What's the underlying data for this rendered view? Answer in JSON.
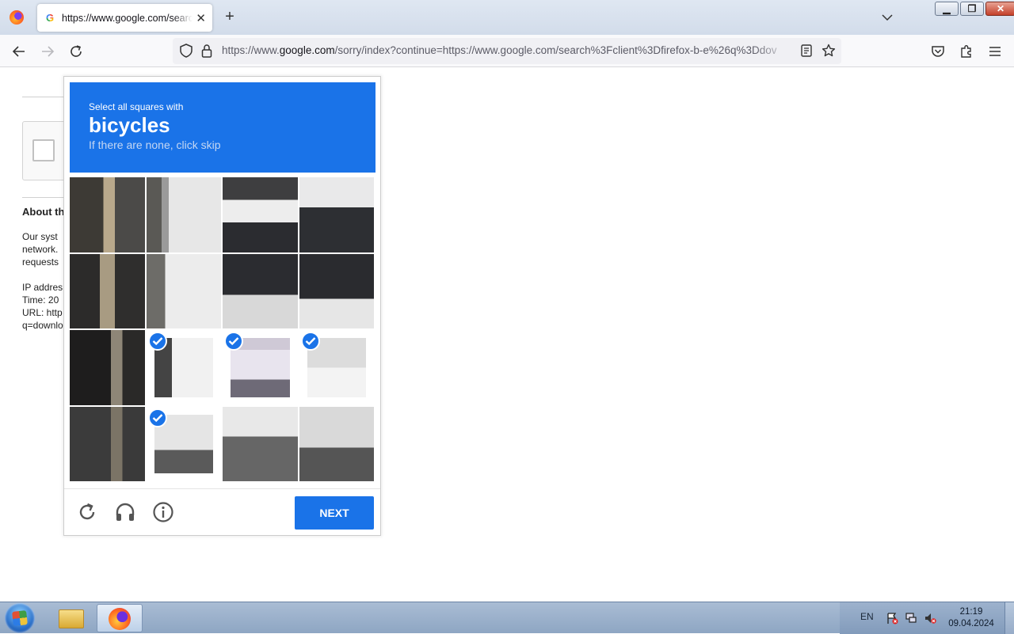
{
  "browser": {
    "tab_title": "https://www.google.com/search",
    "url_host_prefix": "https://www.",
    "url_host": "google.com",
    "url_rest": "/sorry/index?continue=https://www.google.com/search%3Fclient%3Dfirefox-b-e%26q%3Ddov"
  },
  "page": {
    "about_heading": "About th",
    "lines": [
      "Our syst",
      "network.",
      "requests",
      "",
      "IP addres",
      "Time: 20",
      "URL: http",
      "q=downlo"
    ]
  },
  "captcha": {
    "line1": "Select all squares with",
    "keyword": "bicycles",
    "line3": "If there are none, click skip",
    "selected_tiles": [
      9,
      10,
      11,
      13
    ],
    "next_label": "NEXT"
  },
  "taskbar": {
    "lang": "EN",
    "time": "21:19",
    "date": "09.04.2024"
  }
}
